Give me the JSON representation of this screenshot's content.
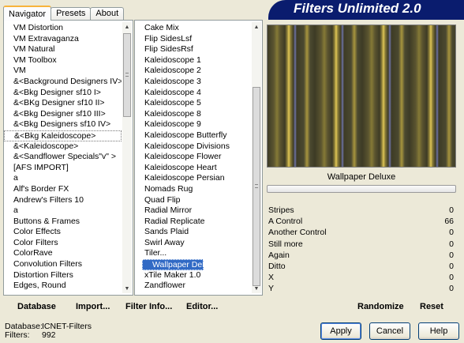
{
  "tabs": [
    {
      "label": "Navigator",
      "active": true
    },
    {
      "label": "Presets",
      "active": false
    },
    {
      "label": "About",
      "active": false
    }
  ],
  "banner": {
    "title": "Filters Unlimited 2.0"
  },
  "categories": [
    "VM Distortion",
    "VM Extravaganza",
    "VM Natural",
    "VM Toolbox",
    "VM",
    "&<Background Designers IV>",
    "&<Bkg Designer sf10 I>",
    "&<BKg Designer sf10 II>",
    "&<Bkg Designer sf10 III>",
    "&<Bkg Designers sf10 IV>",
    "&<Bkg Kaleidoscope>",
    "&<Kaleidoscope>",
    "&<Sandflower Specials\"v\" >",
    "[AFS IMPORT]",
    "a",
    "Alf's Border FX",
    "Andrew's Filters 10",
    "a",
    "Buttons & Frames",
    "Color Effects",
    "Color Filters",
    "ColorRave",
    "Convolution Filters",
    "Distortion Filters",
    "Edges, Round"
  ],
  "categories_selected_index": 10,
  "filters": [
    "Cake Mix",
    "Flip SidesLsf",
    "Flip SidesRsf",
    "Kaleidoscope 1",
    "Kaleidoscope 2",
    "Kaleidoscope 3",
    "Kaleidoscope 4",
    "Kaleidoscope 5",
    "Kaleidoscope 8",
    "Kaleidoscope 9",
    "Kaleidoscope Butterfly",
    "Kaleidoscope Divisions",
    "Kaleidoscope Flower",
    "Kaleidoscope Heart",
    "Kaleidoscope Persian",
    "Nomads Rug",
    "Quad Flip",
    "Radial Mirror",
    "Radial Replicate",
    "Sands Plaid",
    "Swirl Away",
    "Tiler...",
    "Wallpaper Deluxe",
    "xTile Maker 1.0",
    "Zandflower"
  ],
  "filters_selected_index": 22,
  "preview": {
    "filter_name": "Wallpaper Deluxe",
    "progress": 0.0
  },
  "params": [
    {
      "name": "Stripes",
      "value": "0"
    },
    {
      "name": "A Control",
      "value": "66"
    },
    {
      "name": "Another Control",
      "value": "0"
    },
    {
      "name": "Still more",
      "value": "0"
    },
    {
      "name": "Again",
      "value": "0"
    },
    {
      "name": "Ditto",
      "value": "0"
    },
    {
      "name": "X",
      "value": "0"
    },
    {
      "name": "Y",
      "value": "0"
    }
  ],
  "toolbar": {
    "database": "Database",
    "import": "Import...",
    "filter_info": "Filter Info...",
    "editor": "Editor...",
    "randomize": "Randomize",
    "reset": "Reset"
  },
  "status": {
    "database_label": "Database:",
    "database_value": "ICNET-Filters",
    "filters_label": "Filters:",
    "filters_value": "992"
  },
  "buttons": {
    "apply": "Apply",
    "cancel": "Cancel",
    "help": "Help"
  },
  "colors": {
    "banner": "#0a1c6e",
    "selection": "#316ac5",
    "background": "#ece9d8"
  }
}
